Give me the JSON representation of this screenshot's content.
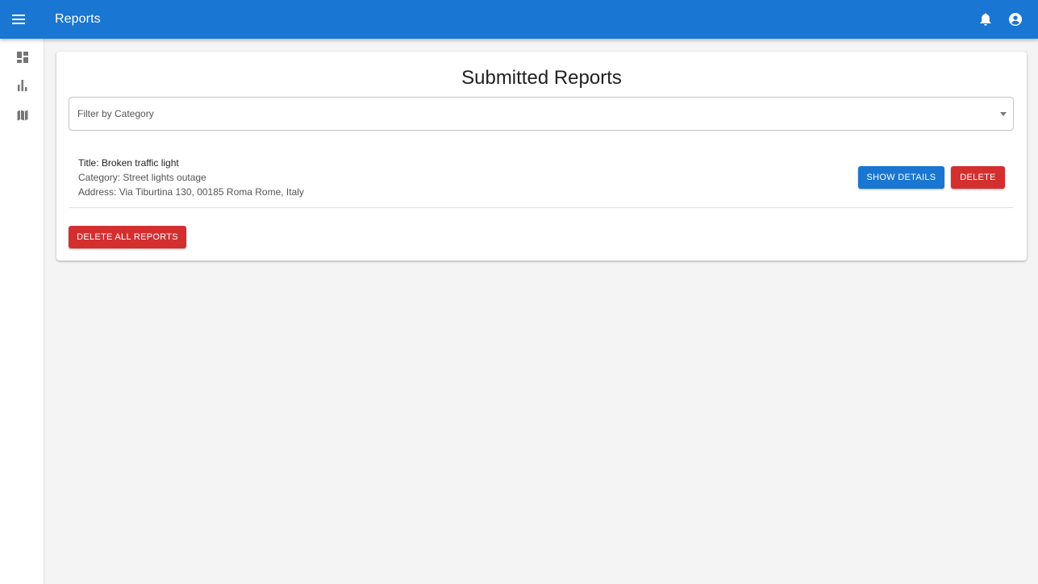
{
  "appbar": {
    "title": "Reports",
    "background": "#1976d2",
    "icons": [
      "menu-icon",
      "bell-icon",
      "account-circle-icon"
    ]
  },
  "sidebar": {
    "items": [
      {
        "icon": "dashboard-icon"
      },
      {
        "icon": "bar-chart-icon"
      },
      {
        "icon": "map-icon"
      }
    ]
  },
  "main": {
    "title": "Submitted Reports",
    "filter": {
      "label": "Filter by Category"
    },
    "reports": [
      {
        "title": "Title: Broken traffic light",
        "category": "Category: Street lights outage",
        "address": "Address: Via Tiburtina 130, 00185 Roma Rome, Italy",
        "show_details_label": "SHOW DETAILS",
        "delete_label": "DELETE"
      }
    ],
    "delete_all_label": "DELETE ALL REPORTS"
  },
  "colors": {
    "primary": "#1976d2",
    "danger": "#d32f2f",
    "background": "#f4f4f4"
  }
}
